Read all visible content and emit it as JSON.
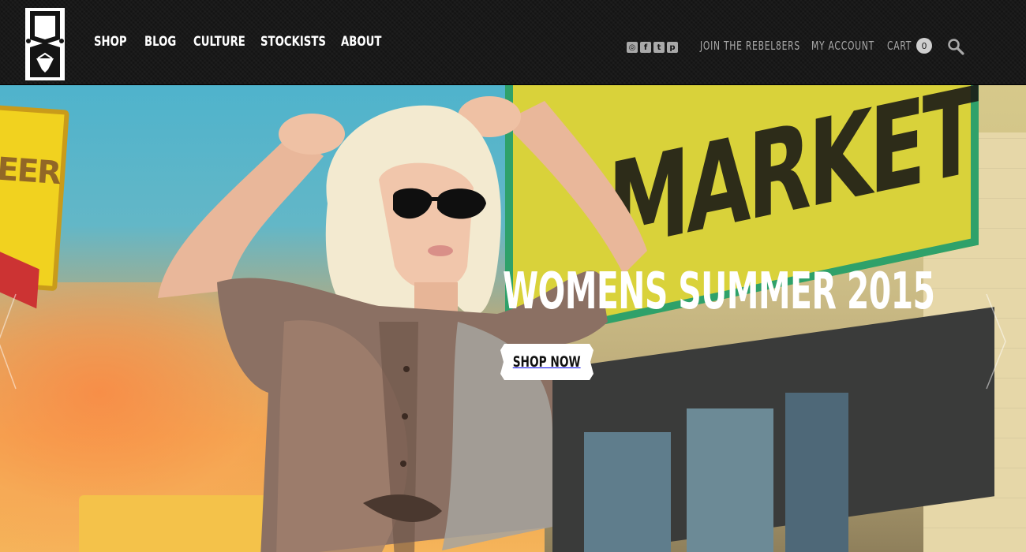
{
  "header": {
    "nav": {
      "shop": "SHOP",
      "blog": "BLOG",
      "culture": "CULTURE",
      "stockists": "STOCKISTS",
      "about": "ABOUT"
    },
    "social": {
      "instagram": "◎",
      "facebook": "f",
      "twitter": "t",
      "pinterest": "p"
    },
    "join_label": "JOIN THE REBEL8ERS",
    "account_label": "MY ACCOUNT",
    "cart_label": "CART",
    "cart_count": "0"
  },
  "hero": {
    "title": "WOMENS SUMMER 2015",
    "button_label": "SHOP NOW",
    "sign_left_text": "EER",
    "market_text": "MARKET"
  },
  "colors": {
    "header_bg": "#141414",
    "nav_text": "#ffffff",
    "util_text": "#a9a9a9",
    "button_bg": "#ffffff"
  },
  "icons": {
    "logo": "rebel8-logo-icon",
    "search": "search-icon",
    "arrow_left": "chevron-left-icon",
    "arrow_right": "chevron-right-icon"
  }
}
